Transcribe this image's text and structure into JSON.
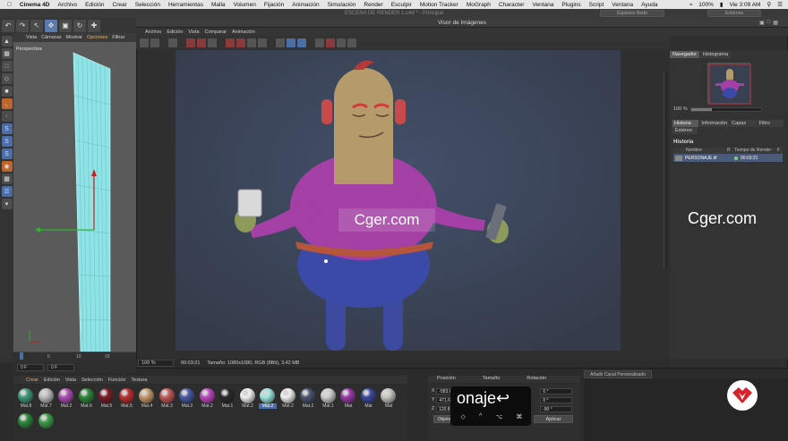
{
  "menubar": {
    "apple": "",
    "app_name": "Cinema 4D",
    "items": [
      "Archivo",
      "Edición",
      "Crear",
      "Selección",
      "Herramientas",
      "Malla",
      "Volumen",
      "Fijación",
      "Animación",
      "Simulación",
      "Render",
      "Esculpir",
      "Motion Tracker",
      "MoGraph",
      "Character",
      "Ventana",
      "Plugins",
      "Script",
      "Ventana",
      "Ayuda"
    ],
    "battery": "100%",
    "clock": "Vie 3:09 AM"
  },
  "c4d": {
    "window_title": "ESCENA DE RENDER 1.c4d * - Principal",
    "layout_field": "Espacios Nodo",
    "search_field": "Entornos"
  },
  "viewport": {
    "menu": [
      "Vista",
      "Cámaras",
      "Mostrar",
      "Opciones",
      "Filtrar"
    ],
    "active_menu": "Opciones",
    "camera_label": "Perspectiva",
    "timeline_ticks": [
      "0",
      "5",
      "10",
      "15"
    ],
    "frame_start": "0 F",
    "frame_current": "0 F"
  },
  "picture_viewer": {
    "title": "Visor de Imágenes",
    "menu": [
      "Archivo",
      "Edición",
      "Vista",
      "Comparar",
      "Animación"
    ],
    "status": {
      "zoom": "100 %",
      "time": "00:03:21",
      "size": "Tamaño: 1080x1080, RGB (8Bit), 3,42 MB"
    },
    "watermark": "Cger.com"
  },
  "navigator": {
    "tabs": [
      "Navegador",
      "Histograma"
    ],
    "zoom": "100 %",
    "zoom_level": 0.3,
    "history_tabs": [
      "Historia",
      "Información",
      "Capas",
      "Filtro"
    ],
    "extra_tab": "Estéreo",
    "history_title": "Historia",
    "columns": {
      "name": "Nombre",
      "r": "R",
      "time": "Tiempo de Render",
      "f": "F"
    },
    "row": {
      "name": "PERSONAJE.tif",
      "time": "00:03:21"
    },
    "watermark": "Cger.com"
  },
  "materials": {
    "menu": [
      "Crear",
      "Edición",
      "Vista",
      "Selección",
      "Función",
      "Textura"
    ],
    "active_menu": "Crear",
    "row1": [
      {
        "label": "Mat.8",
        "color": "#3e9a7a"
      },
      {
        "label": "Mat.7",
        "color": "#bdbdbd"
      },
      {
        "label": "Mat.2",
        "color": "#b04fb4"
      },
      {
        "label": "Mat.6",
        "color": "#2f8a3d"
      },
      {
        "label": "Mat.5",
        "color": "#7a1f26"
      },
      {
        "label": "Mat.5",
        "color": "#c03030"
      },
      {
        "label": "Mat.4",
        "color": "#c89a6a"
      },
      {
        "label": "Mat.3",
        "color": "#c55a5a"
      },
      {
        "label": "Mat.2",
        "color": "#4a5aa8"
      },
      {
        "label": "Mat.2",
        "color": "#c048c0"
      },
      {
        "label": "Mat.1",
        "color": "#2a2a2a"
      },
      {
        "label": "Mat.2",
        "color": "#f2f2f2"
      },
      {
        "label": "Mat.2",
        "color": "#9fe8e0"
      },
      {
        "label": "Mat.2",
        "color": "#f0f0f0"
      },
      {
        "label": "Mat.2",
        "color": "#4a5570"
      },
      {
        "label": "Mat.1",
        "color": "#cfcfcf"
      },
      {
        "label": "Mat",
        "color": "#9a3aa8"
      },
      {
        "label": "Mat",
        "color": "#3a4aa0"
      },
      {
        "label": "Mat",
        "color": "#c8c8c0"
      }
    ],
    "selected_index": 12,
    "row2": [
      {
        "label": "",
        "color": "#2f8a3d"
      },
      {
        "label": "",
        "color": "#3ea04a"
      }
    ]
  },
  "coordinates": {
    "headers": [
      "Posición",
      "Tamaño",
      "Rotación"
    ],
    "rows": [
      {
        "axis": "X",
        "pos": "-583.6",
        "rot": "0 °"
      },
      {
        "axis": "Y",
        "pos": "471.66",
        "rot": "0 °"
      },
      {
        "axis": "Z",
        "pos": "120.81",
        "rot": "-90 °"
      }
    ],
    "object_select": "Objeto",
    "apply": "Aplicar",
    "add_channel": "Añadir Canal Personalizado"
  },
  "keystroke_overlay": {
    "text": "onaje↩",
    "mods": [
      "◇",
      "^",
      "⌥",
      "⌘"
    ]
  },
  "colors": {
    "accent_blue": "#4b6ea8",
    "render_bg": "#39404f",
    "brand_red": "#d6232c"
  }
}
